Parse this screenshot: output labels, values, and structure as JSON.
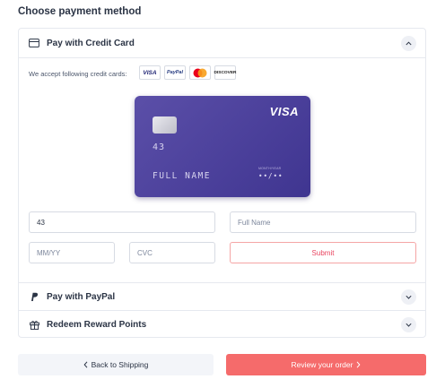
{
  "page": {
    "heading": "Choose payment method"
  },
  "credit_card_section": {
    "title": "Pay with Credit Card",
    "icon": "credit-card-icon",
    "expanded": true,
    "accept_text": "We accept following credit cards:",
    "accepted_cards": [
      "VISA",
      "PayPal",
      "MasterCard",
      "DISCOVER"
    ]
  },
  "card_preview": {
    "brand": "VISA",
    "number": "43",
    "name": "FULL NAME",
    "expiry_label": "MONTH/YEAR",
    "expiry": "••/••"
  },
  "form": {
    "card_number_value": "43",
    "full_name_placeholder": "Full Name",
    "expiry_placeholder": "MM/YY",
    "cvc_placeholder": "CVC",
    "submit_label": "Submit"
  },
  "paypal_section": {
    "title": "Pay with PayPal",
    "icon": "paypal-icon",
    "expanded": false
  },
  "reward_section": {
    "title": "Redeem Reward Points",
    "icon": "gift-icon",
    "expanded": false
  },
  "footer": {
    "back_label": "Back to Shipping",
    "review_label": "Review your order"
  },
  "colors": {
    "accent": "#f56b6b",
    "card": "#4a3f9a",
    "text": "#2b3445"
  }
}
